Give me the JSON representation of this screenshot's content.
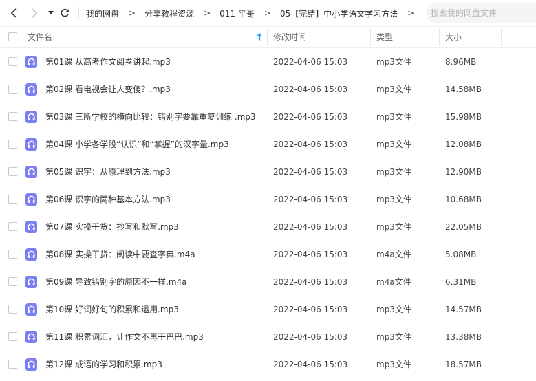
{
  "breadcrumb": [
    "我的网盘",
    "分享教程资源",
    "011 平哥",
    "05【完结】中小学语文学习方法"
  ],
  "breadcrumb_separator": ">",
  "search": {
    "placeholder": "搜索我的网盘文件"
  },
  "columns": {
    "name": "文件名",
    "modified": "修改时间",
    "type": "类型",
    "size": "大小"
  },
  "colors": {
    "audio_icon": "#7b7ff2",
    "sort_arrow": "#2fa3f8"
  },
  "files": [
    {
      "name": "第01课 从高考作文阅卷讲起.mp3",
      "modified": "2022-04-06 15:03",
      "type": "mp3文件",
      "size": "8.96MB"
    },
    {
      "name": "第02课 看电视会让人变傻？.mp3",
      "modified": "2022-04-06 15:03",
      "type": "mp3文件",
      "size": "14.58MB"
    },
    {
      "name": "第03课 三所学校的横向比较：错别字要靠重复训练 .mp3",
      "modified": "2022-04-06 15:03",
      "type": "mp3文件",
      "size": "15.98MB"
    },
    {
      "name": "第04课 小学各学段“认识”和“掌握”的汉字量.mp3",
      "modified": "2022-04-06 15:03",
      "type": "mp3文件",
      "size": "12.08MB"
    },
    {
      "name": "第05课 识字：从原理到方法.mp3",
      "modified": "2022-04-06 15:03",
      "type": "mp3文件",
      "size": "12.90MB"
    },
    {
      "name": "第06课 识字的两种基本方法.mp3",
      "modified": "2022-04-06 15:03",
      "type": "mp3文件",
      "size": "10.68MB"
    },
    {
      "name": "第07课 实操干货：抄写和默写.mp3",
      "modified": "2022-04-06 15:03",
      "type": "mp3文件",
      "size": "22.05MB"
    },
    {
      "name": "第08课 实操干货：阅读中要查字典.m4a",
      "modified": "2022-04-06 15:03",
      "type": "m4a文件",
      "size": "5.08MB"
    },
    {
      "name": "第09课 导致错别字的原因不一样.m4a",
      "modified": "2022-04-06 15:03",
      "type": "m4a文件",
      "size": "6.31MB"
    },
    {
      "name": "第10课 好词好句的积累和运用.mp3",
      "modified": "2022-04-06 15:03",
      "type": "mp3文件",
      "size": "14.57MB"
    },
    {
      "name": "第11课 积累词汇，让作文不再干巴巴.mp3",
      "modified": "2022-04-06 15:03",
      "type": "mp3文件",
      "size": "13.38MB"
    },
    {
      "name": "第12课 成语的学习和积累.mp3",
      "modified": "2022-04-06 15:03",
      "type": "mp3文件",
      "size": "18.57MB"
    }
  ]
}
